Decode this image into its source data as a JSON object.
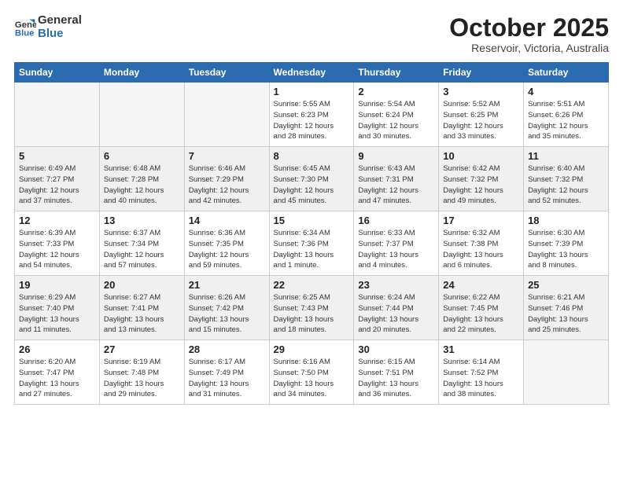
{
  "header": {
    "logo_line1": "General",
    "logo_line2": "Blue",
    "month": "October 2025",
    "location": "Reservoir, Victoria, Australia"
  },
  "days_of_week": [
    "Sunday",
    "Monday",
    "Tuesday",
    "Wednesday",
    "Thursday",
    "Friday",
    "Saturday"
  ],
  "weeks": [
    [
      {
        "day": "",
        "info": "",
        "empty": true
      },
      {
        "day": "",
        "info": "",
        "empty": true
      },
      {
        "day": "",
        "info": "",
        "empty": true
      },
      {
        "day": "1",
        "info": "Sunrise: 5:55 AM\nSunset: 6:23 PM\nDaylight: 12 hours\nand 28 minutes."
      },
      {
        "day": "2",
        "info": "Sunrise: 5:54 AM\nSunset: 6:24 PM\nDaylight: 12 hours\nand 30 minutes."
      },
      {
        "day": "3",
        "info": "Sunrise: 5:52 AM\nSunset: 6:25 PM\nDaylight: 12 hours\nand 33 minutes."
      },
      {
        "day": "4",
        "info": "Sunrise: 5:51 AM\nSunset: 6:26 PM\nDaylight: 12 hours\nand 35 minutes."
      }
    ],
    [
      {
        "day": "5",
        "info": "Sunrise: 6:49 AM\nSunset: 7:27 PM\nDaylight: 12 hours\nand 37 minutes."
      },
      {
        "day": "6",
        "info": "Sunrise: 6:48 AM\nSunset: 7:28 PM\nDaylight: 12 hours\nand 40 minutes."
      },
      {
        "day": "7",
        "info": "Sunrise: 6:46 AM\nSunset: 7:29 PM\nDaylight: 12 hours\nand 42 minutes."
      },
      {
        "day": "8",
        "info": "Sunrise: 6:45 AM\nSunset: 7:30 PM\nDaylight: 12 hours\nand 45 minutes."
      },
      {
        "day": "9",
        "info": "Sunrise: 6:43 AM\nSunset: 7:31 PM\nDaylight: 12 hours\nand 47 minutes."
      },
      {
        "day": "10",
        "info": "Sunrise: 6:42 AM\nSunset: 7:32 PM\nDaylight: 12 hours\nand 49 minutes."
      },
      {
        "day": "11",
        "info": "Sunrise: 6:40 AM\nSunset: 7:32 PM\nDaylight: 12 hours\nand 52 minutes."
      }
    ],
    [
      {
        "day": "12",
        "info": "Sunrise: 6:39 AM\nSunset: 7:33 PM\nDaylight: 12 hours\nand 54 minutes."
      },
      {
        "day": "13",
        "info": "Sunrise: 6:37 AM\nSunset: 7:34 PM\nDaylight: 12 hours\nand 57 minutes."
      },
      {
        "day": "14",
        "info": "Sunrise: 6:36 AM\nSunset: 7:35 PM\nDaylight: 12 hours\nand 59 minutes."
      },
      {
        "day": "15",
        "info": "Sunrise: 6:34 AM\nSunset: 7:36 PM\nDaylight: 13 hours\nand 1 minute."
      },
      {
        "day": "16",
        "info": "Sunrise: 6:33 AM\nSunset: 7:37 PM\nDaylight: 13 hours\nand 4 minutes."
      },
      {
        "day": "17",
        "info": "Sunrise: 6:32 AM\nSunset: 7:38 PM\nDaylight: 13 hours\nand 6 minutes."
      },
      {
        "day": "18",
        "info": "Sunrise: 6:30 AM\nSunset: 7:39 PM\nDaylight: 13 hours\nand 8 minutes."
      }
    ],
    [
      {
        "day": "19",
        "info": "Sunrise: 6:29 AM\nSunset: 7:40 PM\nDaylight: 13 hours\nand 11 minutes."
      },
      {
        "day": "20",
        "info": "Sunrise: 6:27 AM\nSunset: 7:41 PM\nDaylight: 13 hours\nand 13 minutes."
      },
      {
        "day": "21",
        "info": "Sunrise: 6:26 AM\nSunset: 7:42 PM\nDaylight: 13 hours\nand 15 minutes."
      },
      {
        "day": "22",
        "info": "Sunrise: 6:25 AM\nSunset: 7:43 PM\nDaylight: 13 hours\nand 18 minutes."
      },
      {
        "day": "23",
        "info": "Sunrise: 6:24 AM\nSunset: 7:44 PM\nDaylight: 13 hours\nand 20 minutes."
      },
      {
        "day": "24",
        "info": "Sunrise: 6:22 AM\nSunset: 7:45 PM\nDaylight: 13 hours\nand 22 minutes."
      },
      {
        "day": "25",
        "info": "Sunrise: 6:21 AM\nSunset: 7:46 PM\nDaylight: 13 hours\nand 25 minutes."
      }
    ],
    [
      {
        "day": "26",
        "info": "Sunrise: 6:20 AM\nSunset: 7:47 PM\nDaylight: 13 hours\nand 27 minutes."
      },
      {
        "day": "27",
        "info": "Sunrise: 6:19 AM\nSunset: 7:48 PM\nDaylight: 13 hours\nand 29 minutes."
      },
      {
        "day": "28",
        "info": "Sunrise: 6:17 AM\nSunset: 7:49 PM\nDaylight: 13 hours\nand 31 minutes."
      },
      {
        "day": "29",
        "info": "Sunrise: 6:16 AM\nSunset: 7:50 PM\nDaylight: 13 hours\nand 34 minutes."
      },
      {
        "day": "30",
        "info": "Sunrise: 6:15 AM\nSunset: 7:51 PM\nDaylight: 13 hours\nand 36 minutes."
      },
      {
        "day": "31",
        "info": "Sunrise: 6:14 AM\nSunset: 7:52 PM\nDaylight: 13 hours\nand 38 minutes."
      },
      {
        "day": "",
        "info": "",
        "empty": true
      }
    ]
  ]
}
